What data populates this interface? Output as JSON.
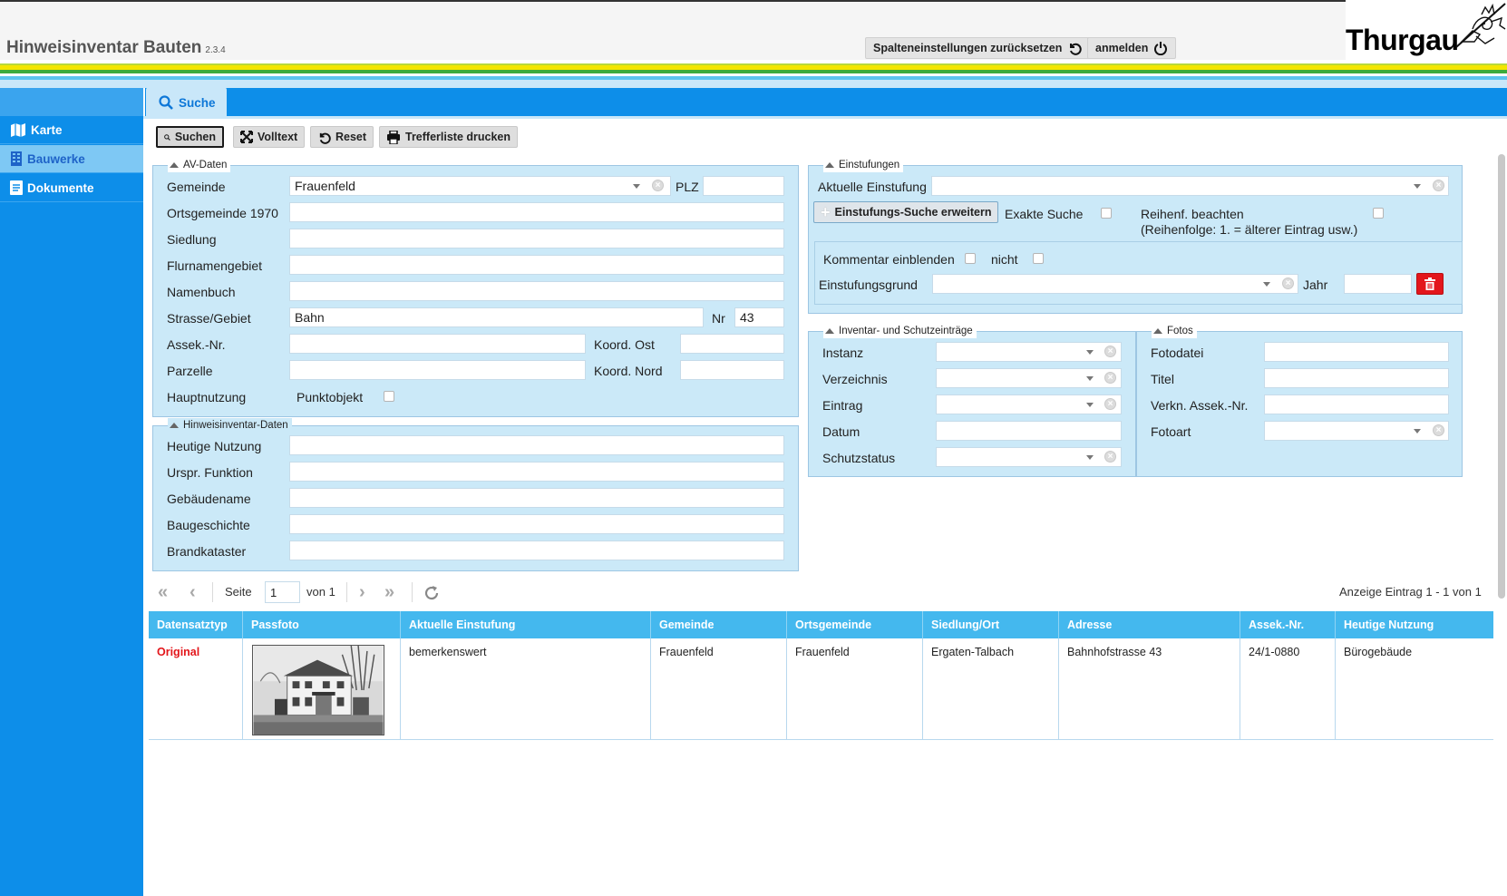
{
  "header": {
    "title": "Hinweisinventar Bauten",
    "version": "2.3.4",
    "reset_columns_label": "Spalteneinstellungen zurücksetzen",
    "login_label": "anmelden",
    "logo_text": "Thurgau"
  },
  "colors": {
    "primary_blue": "#0d8ee9",
    "panel_blue": "#cbe9f8",
    "stripe_yellow": "#f4e600",
    "stripe_green": "#3cab3c",
    "grid_header": "#44b8ee",
    "delete_red": "#e3161b",
    "status_red": "#e3161b"
  },
  "sidebar": {
    "items": [
      {
        "label": "Karte",
        "icon": "map-icon"
      },
      {
        "label": "Bauwerke",
        "icon": "building-icon"
      },
      {
        "label": "Dokumente",
        "icon": "document-icon"
      }
    ]
  },
  "tabs": [
    {
      "label": "Suche",
      "icon": "search-icon",
      "active": true
    }
  ],
  "toolbar": {
    "search_label": "Suchen",
    "fulltext_label": "Volltext",
    "reset_label": "Reset",
    "print_label": "Trefferliste drucken"
  },
  "av_daten": {
    "legend": "AV-Daten",
    "gemeinde_label": "Gemeinde",
    "gemeinde_value": "Frauenfeld",
    "plz_label": "PLZ",
    "plz_value": "",
    "ortsgemeinde_label": "Ortsgemeinde 1970",
    "siedlung_label": "Siedlung",
    "flurnamengebiet_label": "Flurnamengebiet",
    "namenbuch_label": "Namenbuch",
    "strasse_label": "Strasse/Gebiet",
    "strasse_value": "Bahn",
    "nr_label": "Nr",
    "nr_value": "43",
    "assek_label": "Assek.-Nr.",
    "koord_ost_label": "Koord. Ost",
    "parzelle_label": "Parzelle",
    "koord_nord_label": "Koord. Nord",
    "hauptnutzung_label": "Hauptnutzung",
    "punktobjekt_label": "Punktobjekt"
  },
  "hinweis_daten": {
    "legend": "Hinweisinventar-Daten",
    "heutige_nutzung_label": "Heutige Nutzung",
    "urspr_funktion_label": "Urspr. Funktion",
    "gebaeudename_label": "Gebäudename",
    "baugeschichte_label": "Baugeschichte",
    "brandkataster_label": "Brandkataster"
  },
  "einstufungen": {
    "legend": "Einstufungen",
    "aktuelle_einstufung_label": "Aktuelle Einstufung",
    "erweitern_label": "Einstufungs-Suche erweitern",
    "exakte_suche_label": "Exakte Suche",
    "reihenfolge_label": "Reihenf. beachten",
    "reihenfolge_hint": "(Reihenfolge: 1. = älterer Eintrag usw.)",
    "kommentar_label": "Kommentar einblenden",
    "nicht_label": "nicht",
    "einstufungsgrund_label": "Einstufungsgrund",
    "jahr_label": "Jahr"
  },
  "inventar": {
    "legend": "Inventar- und Schutzeinträge",
    "instanz_label": "Instanz",
    "verzeichnis_label": "Verzeichnis",
    "eintrag_label": "Eintrag",
    "datum_label": "Datum",
    "schutzstatus_label": "Schutzstatus"
  },
  "fotos": {
    "legend": "Fotos",
    "fotodatei_label": "Fotodatei",
    "titel_label": "Titel",
    "verkn_label": "Verkn. Assek.-Nr.",
    "fotoart_label": "Fotoart"
  },
  "pager": {
    "seite_label": "Seite",
    "page_value": "1",
    "von_label": "von 1",
    "summary": "Anzeige Eintrag 1 - 1 von 1"
  },
  "grid": {
    "columns": [
      "Datensatztyp",
      "Passfoto",
      "Aktuelle Einstufung",
      "Gemeinde",
      "Ortsgemeinde",
      "Siedlung/Ort",
      "Adresse",
      "Assek.-Nr.",
      "Heutige Nutzung"
    ],
    "rows": [
      {
        "datensatztyp": "Original",
        "einstufung": "bemerkenswert",
        "gemeinde": "Frauenfeld",
        "ortsgemeinde": "Frauenfeld",
        "siedlung": "Ergaten-Talbach",
        "adresse": "Bahnhofstrasse 43",
        "assek": "24/1-0880",
        "nutzung": "Bürogebäude"
      }
    ]
  }
}
